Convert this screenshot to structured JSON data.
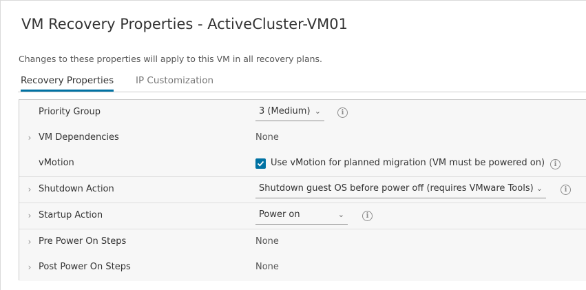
{
  "dialog": {
    "title": "VM Recovery Properties - ActiveCluster-VM01",
    "subtitle": "Changes to these properties will apply to this VM in all recovery plans."
  },
  "tabs": [
    {
      "label": "Recovery Properties",
      "active": true
    },
    {
      "label": "IP Customization",
      "active": false
    }
  ],
  "rows": {
    "priority_group": {
      "label": "Priority Group",
      "value": "3 (Medium)"
    },
    "vm_dependencies": {
      "label": "VM Dependencies",
      "value": "None"
    },
    "vmotion": {
      "label": "vMotion",
      "checkbox_label": "Use vMotion for planned migration (VM must be powered on)",
      "checked": true
    },
    "shutdown_action": {
      "label": "Shutdown Action",
      "value": "Shutdown guest OS before power off (requires VMware Tools)"
    },
    "startup_action": {
      "label": "Startup Action",
      "value": "Power on"
    },
    "pre_power_on": {
      "label": "Pre Power On Steps",
      "value": "None"
    },
    "post_power_on": {
      "label": "Post Power On Steps",
      "value": "None"
    }
  },
  "icons": {
    "expand": "chevron-right-icon",
    "dropdown": "chevron-down-icon",
    "info": "info-icon",
    "check": "checkmark-icon"
  },
  "colors": {
    "accent": "#0072a3",
    "row_background": "#f7f7f7"
  }
}
